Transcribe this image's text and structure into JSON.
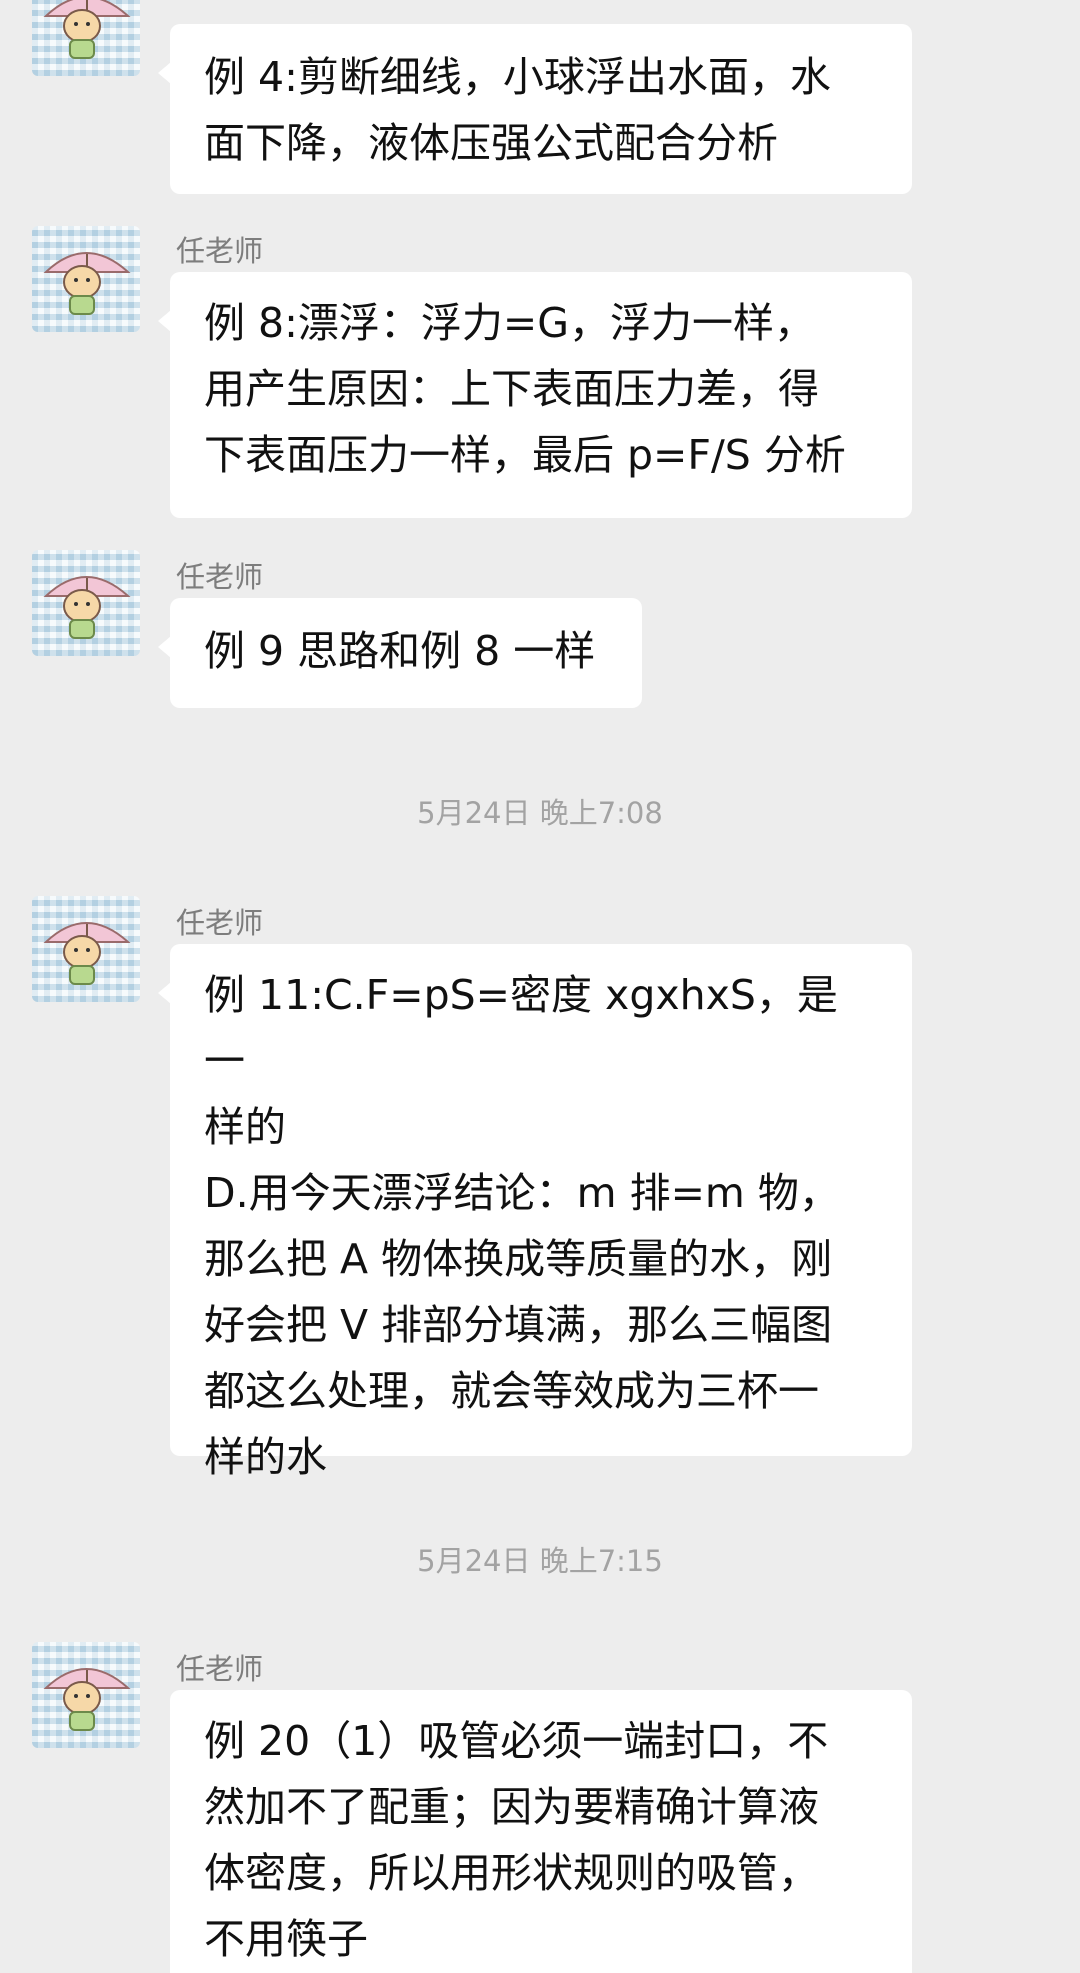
{
  "messages": [
    {
      "sender": "",
      "text": "例 4:剪断细线，小球浮出水面，水\n面下降，液体压强公式配合分析"
    },
    {
      "sender": "任老师",
      "text": "例 8:漂浮：浮力=G，浮力一样，\n用产生原因：上下表面压力差，得\n下表面压力一样，最后 p=F/S 分析"
    },
    {
      "sender": "任老师",
      "text": "例 9 思路和例 8 一样"
    },
    {
      "sender": "任老师",
      "text": "例 11:C.F=pS=密度 xgxhxS，是一\n样的\nD.用今天漂浮结论：m 排=m 物，\n那么把 A 物体换成等质量的水，刚\n好会把 V 排部分填满，那么三幅图\n都这么处理，就会等效成为三杯一\n样的水"
    },
    {
      "sender": "任老师",
      "text": "例 20（1）吸管必须一端封口，不\n然加不了配重；因为要精确计算液\n体密度，所以用形状规则的吸管，\n不用筷子"
    }
  ],
  "timestamps": [
    "5月24日 晚上7:08",
    "5月24日 晚上7:15"
  ],
  "avatar_icon": "girl-with-umbrella-avatar-icon"
}
